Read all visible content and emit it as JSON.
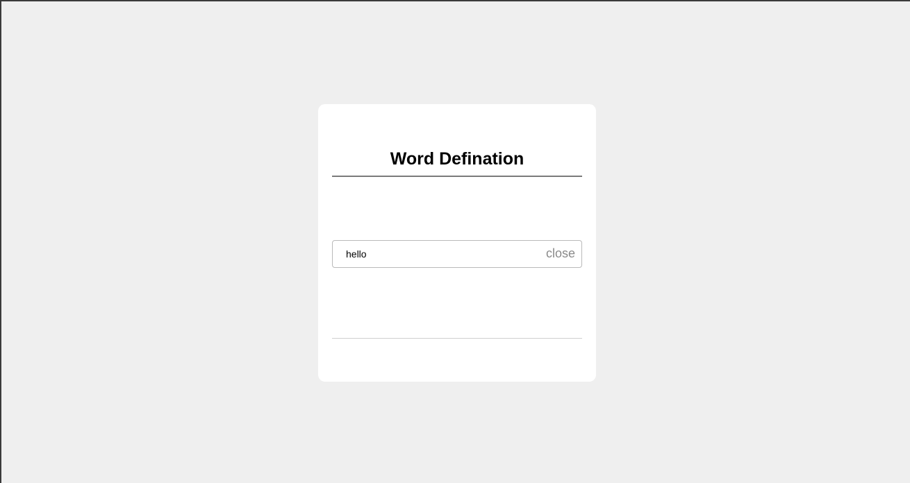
{
  "card": {
    "title": "Word Defination"
  },
  "search": {
    "value": "hello",
    "close_label": "close"
  },
  "colors": {
    "page_background": "#efefef",
    "card_background": "#ffffff",
    "title_rule": "#7a7a7a",
    "close_text": "#8a8a8a"
  }
}
